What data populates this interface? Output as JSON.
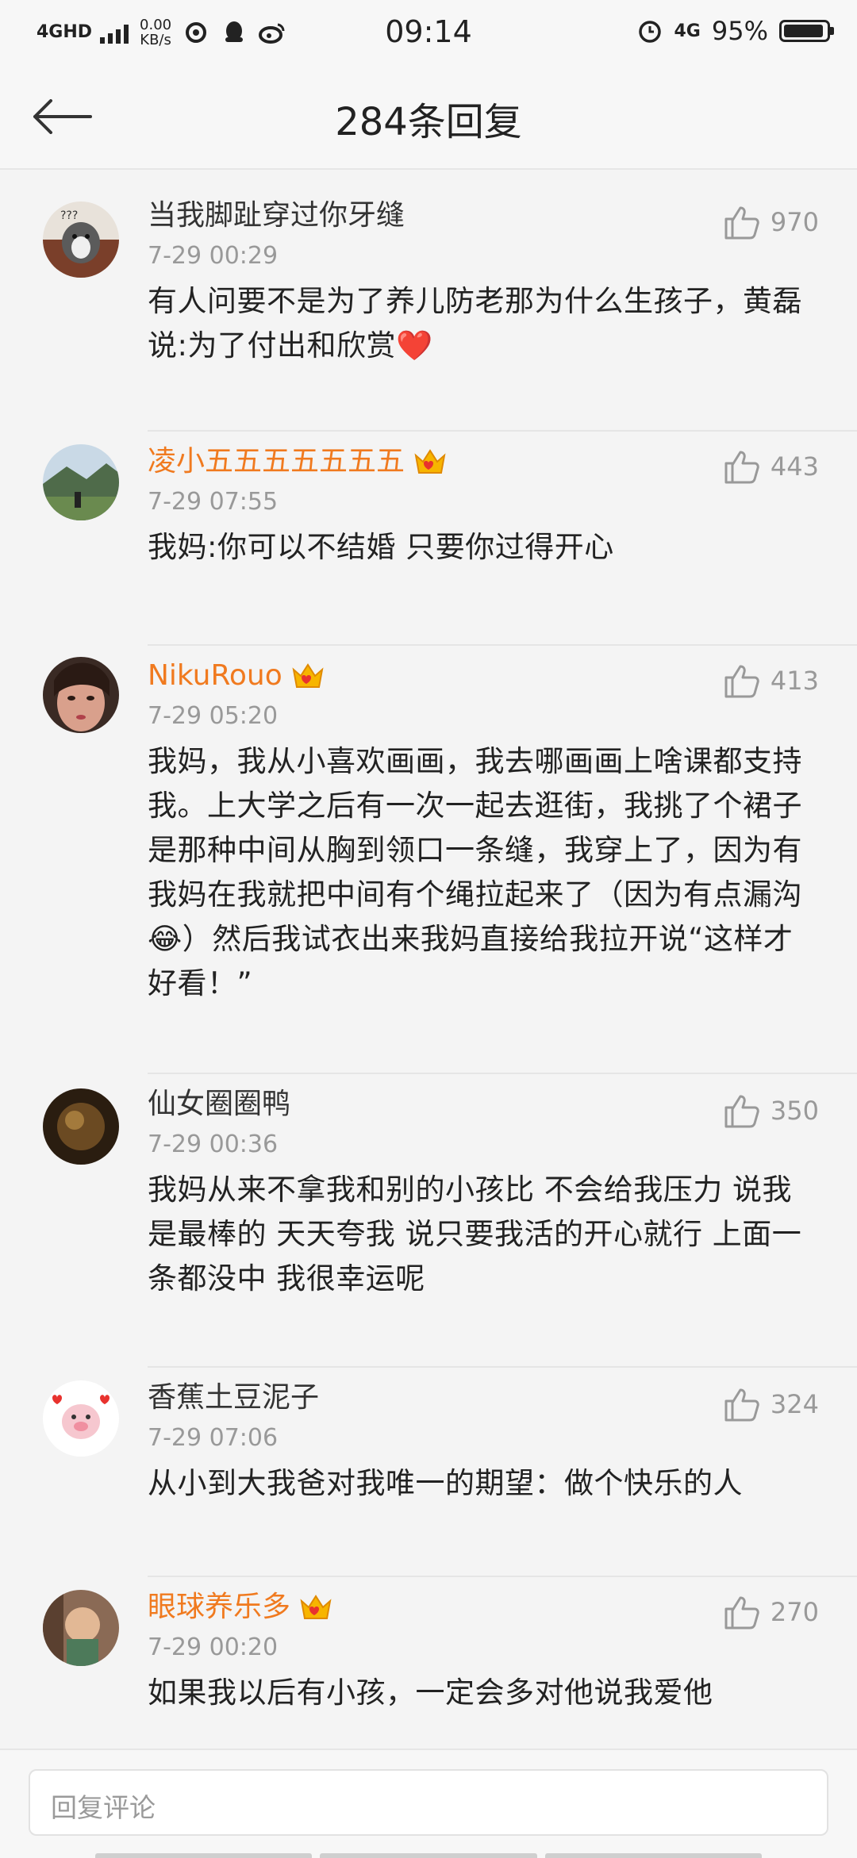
{
  "status_bar": {
    "network_label": "4GHD",
    "speed_value": "0.00",
    "speed_unit": "KB/s",
    "time": "09:14",
    "network_right": "4G",
    "battery_percent": "95%",
    "battery_level": 0.95
  },
  "header": {
    "title": "284条回复"
  },
  "comments": [
    {
      "username": "当我脚趾穿过你牙缝",
      "vip": false,
      "time": "7-29 00:29",
      "likes": "970",
      "text": "有人问要不是为了养儿防老那为什么生孩子，黄磊说:为了付出和欣赏❤️"
    },
    {
      "username": "凌小五五五五五五五",
      "vip": true,
      "time": "7-29 07:55",
      "likes": "443",
      "text": "我妈:你可以不结婚 只要你过得开心"
    },
    {
      "username": "NikuRouo",
      "vip": true,
      "time": "7-29 05:20",
      "likes": "413",
      "text": "我妈，我从小喜欢画画，我去哪画画上啥课都支持我。上大学之后有一次一起去逛街，我挑了个裙子是那种中间从胸到领口一条缝，我穿上了，因为有我妈在我就把中间有个绳拉起来了（因为有点漏沟😂）然后我试衣出来我妈直接给我拉开说“这样才好看！”"
    },
    {
      "username": "仙女圈圈鸭",
      "vip": false,
      "time": "7-29 00:36",
      "likes": "350",
      "text": "我妈从来不拿我和别的小孩比 不会给我压力 说我是最棒的 天天夸我 说只要我活的开心就行 上面一条都没中 我很幸运呢"
    },
    {
      "username": "香蕉土豆泥子",
      "vip": false,
      "time": "7-29 07:06",
      "likes": "324",
      "text": "从小到大我爸对我唯一的期望：做个快乐的人"
    },
    {
      "username": "眼球养乐多",
      "vip": true,
      "time": "7-29 00:20",
      "likes": "270",
      "text": "如果我以后有小孩，一定会多对他说我爱他"
    }
  ],
  "reply_bar": {
    "placeholder": "回复评论"
  },
  "colors": {
    "vip_name": "#f07a1f",
    "plain_name": "#333333",
    "timestamp": "#999999"
  }
}
